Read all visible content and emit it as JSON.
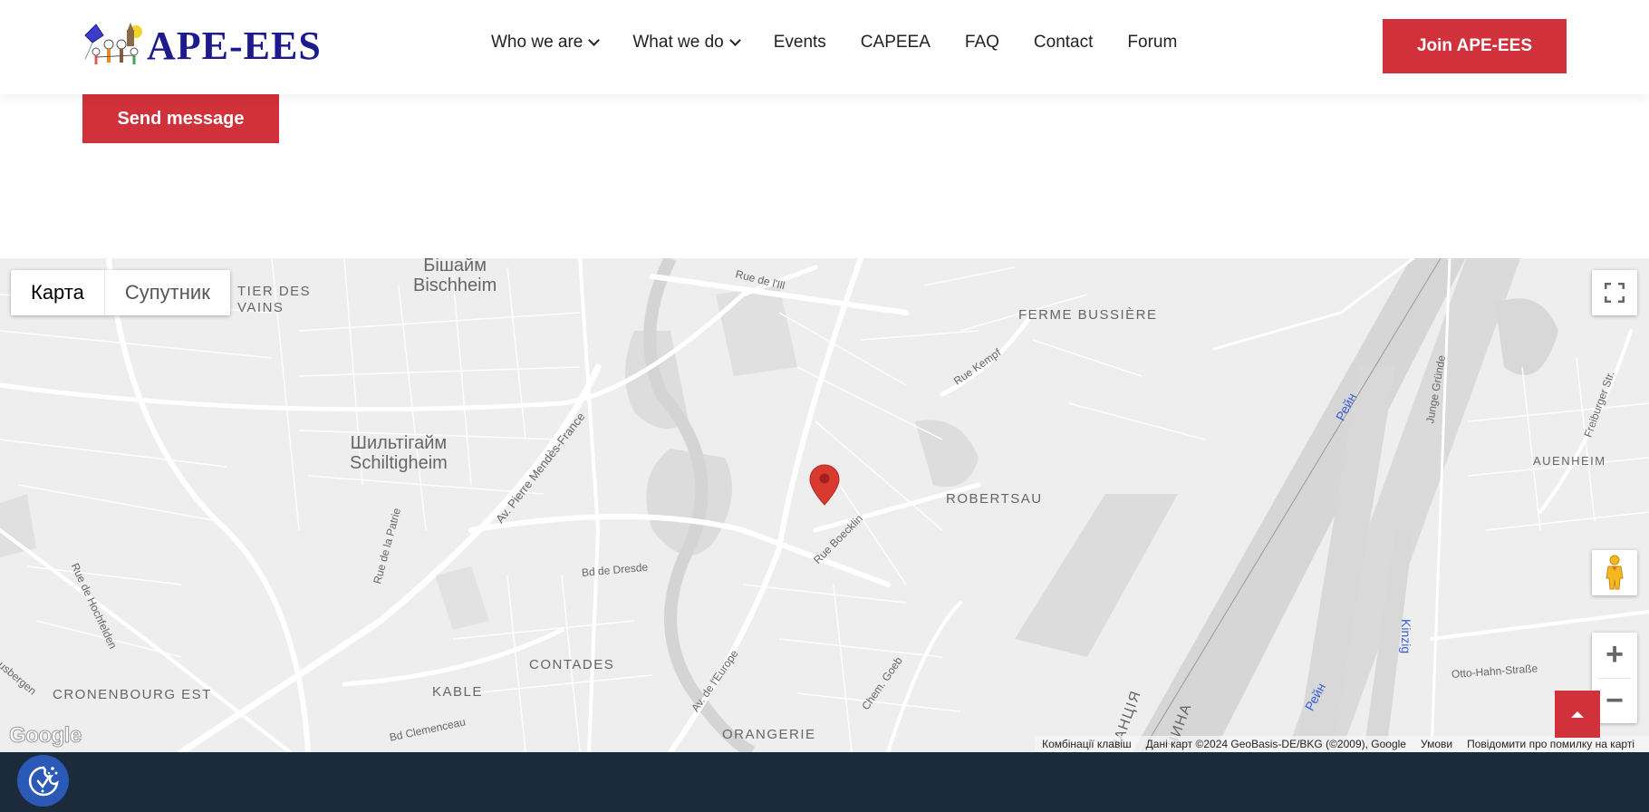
{
  "header": {
    "logo_text": "APE-EES",
    "nav": [
      {
        "label": "Who we are",
        "has_dropdown": true
      },
      {
        "label": "What we do",
        "has_dropdown": true
      },
      {
        "label": "Events",
        "has_dropdown": false
      },
      {
        "label": "CAPEEA",
        "has_dropdown": false
      },
      {
        "label": "FAQ",
        "has_dropdown": false
      },
      {
        "label": "Contact",
        "has_dropdown": false
      },
      {
        "label": "Forum",
        "has_dropdown": false
      }
    ],
    "join_label": "Join APE-EES"
  },
  "form": {
    "send_label": "Send message"
  },
  "map": {
    "map_type": {
      "map_label": "Карта",
      "satellite_label": "Супутник",
      "selected": "Карта"
    },
    "districts": [
      "FERME BUSSIÈRE",
      "ROBERTSAU",
      "AUENHEIM",
      "CRONENBOURG EST",
      "KABLE",
      "CONTADES",
      "ORANGERIE",
      "TIER DES",
      "VAINS"
    ],
    "cities": [
      {
        "line1": "Бішайм",
        "line2": "Bischheim"
      },
      {
        "line1": "Шильтігайм",
        "line2": "Schiltigheim"
      }
    ],
    "streets": [
      "Rue de l'Ill",
      "Rue Kempf",
      "Av. Pierre Mendès-France",
      "Rue de la Patrie",
      "Rue de Hochfelden",
      "Bd de Dresde",
      "Rue Boecklin",
      "Av. de l'Europe",
      "Chem. Goeb",
      "Bd Clemenceau",
      "Junge Gründe",
      "Freiburger Str.",
      "Otto-Hahn-Straße",
      "usbergen"
    ],
    "rivers": [
      "Рейн",
      "Рейн",
      "Kinzig"
    ],
    "border_labels": [
      "РАНЦІЯ",
      "ЧИНА"
    ],
    "google_logo": "Google",
    "attribution": {
      "shortcuts": "Комбінації клавіш",
      "data": "Дані карт ©2024 GeoBasis-DE/BKG (©2009), Google",
      "terms": "Умови",
      "report": "Повідомити про помилку на карті"
    },
    "controls": {
      "fullscreen": "fullscreen-icon",
      "pegman": "pegman-icon",
      "zoom_in": "+",
      "zoom_out": "−"
    },
    "marker_color": "#d93a30"
  },
  "colors": {
    "accent": "#d0313a",
    "footer": "#1c2b3c",
    "cookie": "#2a5ab5",
    "logo_text": "#1c1a8c"
  }
}
